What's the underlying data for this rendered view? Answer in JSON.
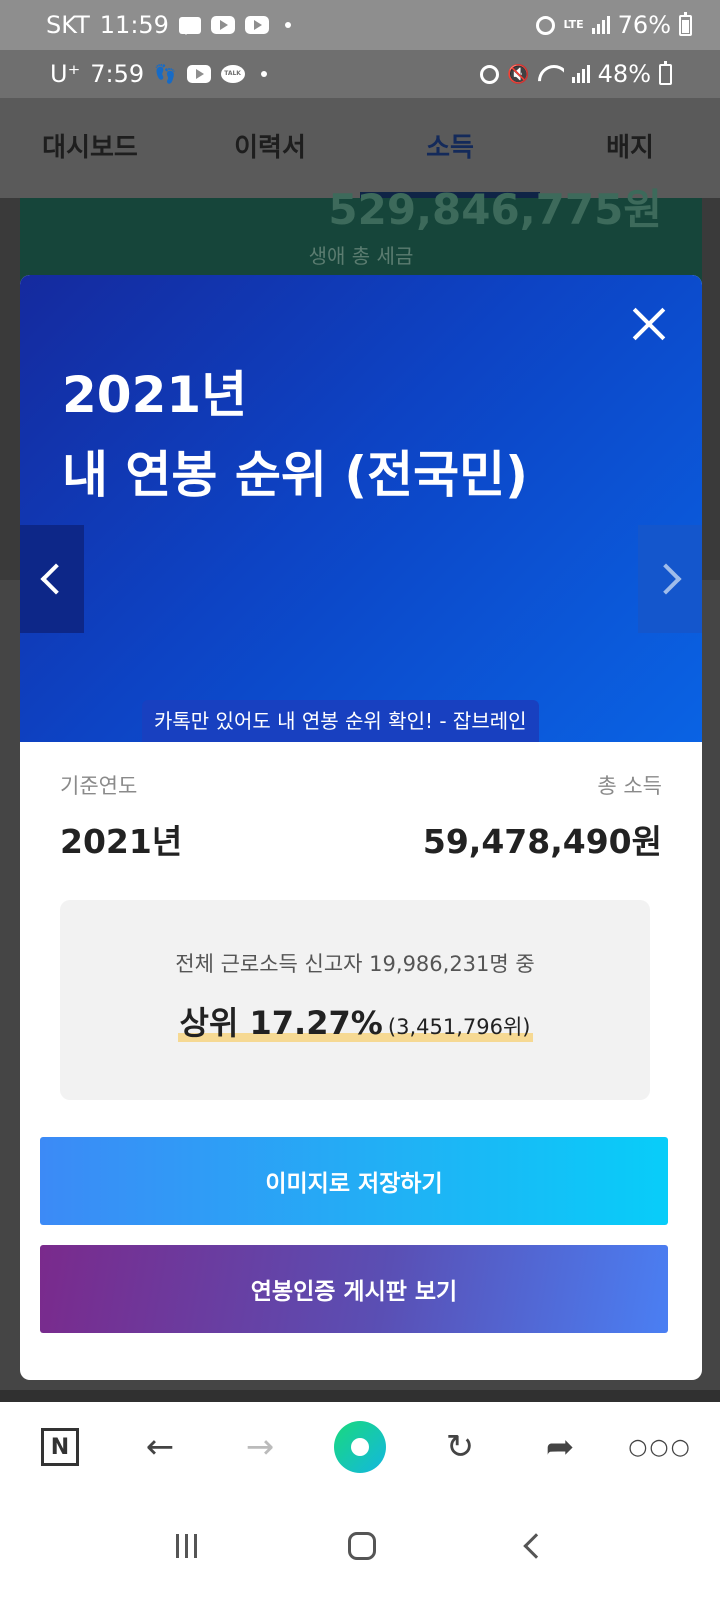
{
  "outer_status": {
    "carrier": "SKT",
    "time": "11:59",
    "network": "LTE",
    "battery": "76%"
  },
  "inner_status": {
    "carrier": "U⁺",
    "time": "7:59",
    "talk_label": "TALK",
    "battery": "48%"
  },
  "tabs": [
    {
      "label": "대시보드"
    },
    {
      "label": "이력서"
    },
    {
      "label": "소득",
      "active": true
    },
    {
      "label": "배지"
    }
  ],
  "background": {
    "amount_partial": "529,846,775원",
    "lifetime_tax_label": "생애 총 세금"
  },
  "modal": {
    "title_line1": "2021년",
    "title_line2": "내 연봉 순위 (전국민)",
    "ad_text": "카톡만 있어도 내 연봉 순위 확인! - 잡브레인",
    "base_year_label": "기준연도",
    "base_year_value": "2021년",
    "total_income_label": "총 소득",
    "total_income_value": "59,478,490원",
    "rank_context": "전체 근로소득 신고자 19,986,231명 중",
    "rank_percent": "상위 17.27%",
    "rank_position": "(3,451,796위)",
    "save_button": "이미지로 저장하기",
    "board_button": "연봉인증 게시판 보기"
  },
  "browser_toolbar": {
    "n_label": "N",
    "back": "←",
    "forward": "→",
    "reload": "↻",
    "share": "➦",
    "more": "○○○"
  },
  "colors": {
    "banner_blue": "#0d43c4",
    "save_button": "#1fb3f5",
    "board_button_start": "#7a2a8c",
    "board_button_end": "#4a7ff3",
    "highlight": "#f6d27a"
  }
}
